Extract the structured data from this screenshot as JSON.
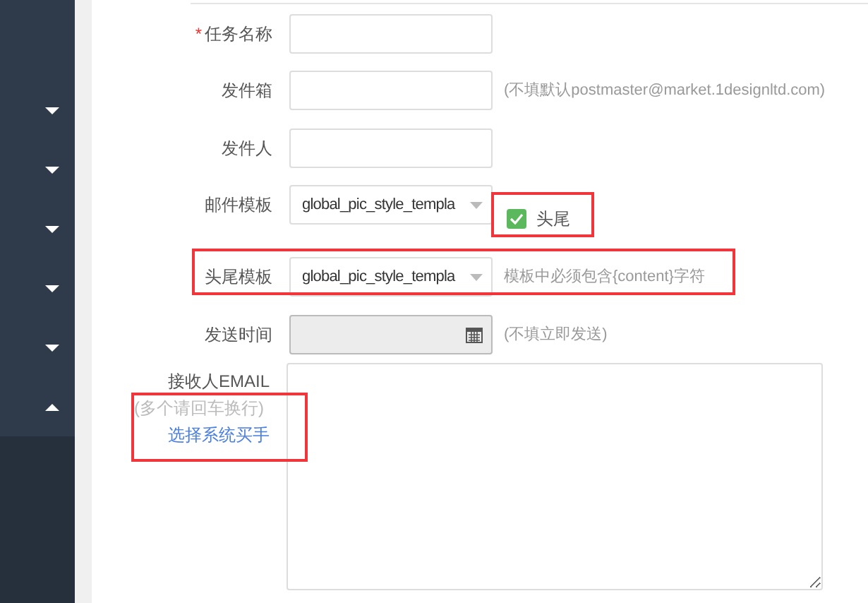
{
  "sidebar": {
    "items": [
      {
        "expanded": false
      },
      {
        "expanded": false
      },
      {
        "expanded": false
      },
      {
        "expanded": false
      },
      {
        "expanded": false
      },
      {
        "expanded": true
      }
    ]
  },
  "form": {
    "fields": [
      {
        "kind": "text",
        "label": "任务名称",
        "required_mark": "*",
        "disabled": false
      },
      {
        "kind": "text",
        "label": "发件箱",
        "disabled": false,
        "hint": "(不填默认postmaster@market.1designltd.com)"
      },
      {
        "kind": "text",
        "label": "发件人",
        "disabled": false
      },
      {
        "kind": "select",
        "label": "邮件模板",
        "disabled": false,
        "value": "global_pic_style_templa",
        "checkbox": {
          "label": "头尾",
          "checked": true
        }
      },
      {
        "kind": "select",
        "label": "头尾模板",
        "disabled": false,
        "value": "global_pic_style_templa",
        "hint": "模板中必须包含{content}字符"
      },
      {
        "kind": "date",
        "label": "发送时间",
        "disabled": true,
        "hint": "(不填立即发送)"
      },
      {
        "kind": "textarea",
        "label": "接收人EMAIL",
        "disabled": false,
        "note": "(多个请回车换行)",
        "link": "选择系统买手"
      }
    ]
  }
}
